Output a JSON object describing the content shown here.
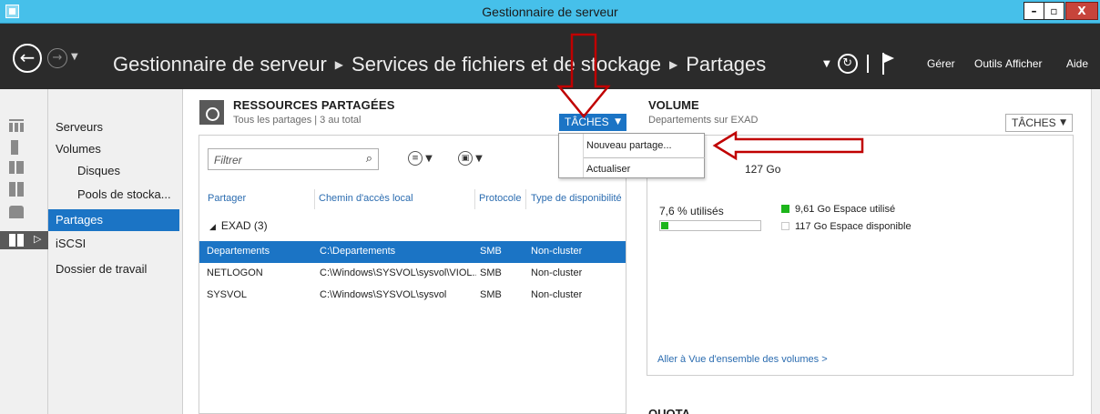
{
  "window": {
    "title": "Gestionnaire de serveur"
  },
  "header": {
    "breadcrumb": [
      "Gestionnaire de serveur",
      "Services de fichiers et de stockage",
      "Partages"
    ],
    "menu": [
      "Gérer",
      "Outils",
      "Afficher",
      "Aide"
    ]
  },
  "nav": {
    "items": [
      "Serveurs",
      "Volumes",
      "Disques",
      "Pools de stocka...",
      "Partages",
      "iSCSI",
      "Dossier de travail"
    ],
    "selected": "Partages"
  },
  "shares": {
    "title": "RESSOURCES PARTAGÉES",
    "subtitle": "Tous les partages | 3 au total",
    "tasks_label": "TÂCHES",
    "filter_placeholder": "Filtrer",
    "columns": [
      "Partager",
      "Chemin d'accès local",
      "Protocole",
      "Type de disponibilité"
    ],
    "group": "EXAD (3)",
    "rows": [
      {
        "name": "Departements",
        "path": "C:\\Departements",
        "protocol": "SMB",
        "availability": "Non-cluster"
      },
      {
        "name": "NETLOGON",
        "path": "C:\\Windows\\SYSVOL\\sysvol\\VIOL...",
        "protocol": "SMB",
        "availability": "Non-cluster"
      },
      {
        "name": "SYSVOL",
        "path": "C:\\Windows\\SYSVOL\\sysvol",
        "protocol": "SMB",
        "availability": "Non-cluster"
      }
    ],
    "selected_row": "Departements"
  },
  "tasks_menu": {
    "items": [
      "Nouveau partage...",
      "Actualiser"
    ]
  },
  "volume": {
    "title": "VOLUME",
    "subtitle": "Departements sur EXAD",
    "tasks_label": "TÂCHES",
    "capacity": "127 Go",
    "used_percent_label": "7,6 % utilisés",
    "used_fraction": 0.076,
    "used_legend": "9,61 Go Espace utilisé",
    "free_legend": "117 Go Espace disponible",
    "link": "Aller à Vue d'ensemble des volumes >",
    "colors": {
      "used": "#1db51b",
      "free": "#ffffff"
    }
  },
  "quota": {
    "title": "QUOTA"
  },
  "colors": {
    "accent": "#1b74c5",
    "header": "#2b2b2b",
    "titlebar": "#46c0ea",
    "annotation": "#c00000"
  }
}
